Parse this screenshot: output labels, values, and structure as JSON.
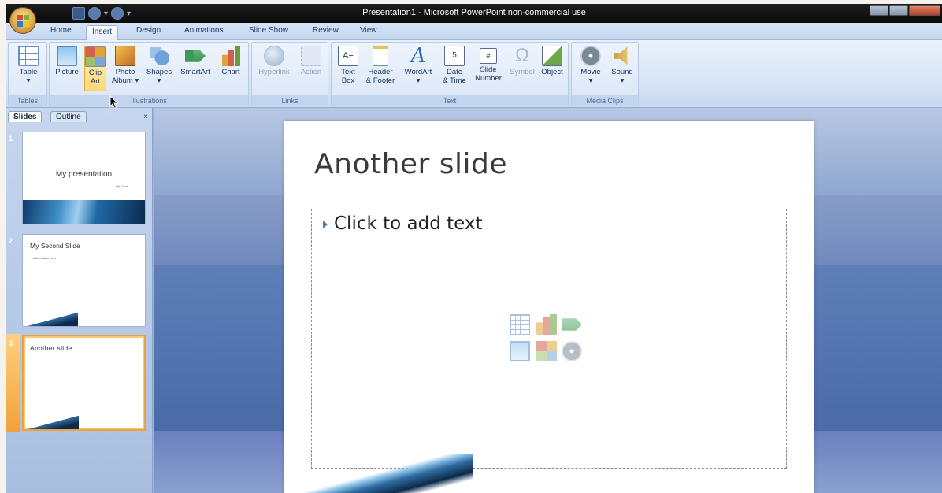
{
  "window": {
    "title": "Presentation1 - Microsoft PowerPoint non-commercial use"
  },
  "ribbon_tabs": [
    "Home",
    "Insert",
    "Design",
    "Animations",
    "Slide Show",
    "Review",
    "View"
  ],
  "active_tab": "Insert",
  "groups": {
    "tables": {
      "label": "Tables",
      "buttons": {
        "table": "Table"
      }
    },
    "illustrations": {
      "label": "Illustrations",
      "buttons": {
        "picture": "Picture",
        "clip_art_1": "Clip",
        "clip_art_2": "Art",
        "photo_album_1": "Photo",
        "photo_album_2": "Album",
        "shapes": "Shapes",
        "smartart": "SmartArt",
        "chart": "Chart"
      }
    },
    "links": {
      "label": "Links",
      "buttons": {
        "hyperlink": "Hyperlink",
        "action": "Action"
      }
    },
    "text": {
      "label": "Text",
      "buttons": {
        "text_box_1": "Text",
        "text_box_2": "Box",
        "header_footer_1": "Header",
        "header_footer_2": "& Footer",
        "wordart": "WordArt",
        "date_time_1": "Date",
        "date_time_2": "& Time",
        "slide_number_1": "Slide",
        "slide_number_2": "Number",
        "symbol": "Symbol",
        "object": "Object"
      }
    },
    "media": {
      "label": "Media Clips",
      "buttons": {
        "movie": "Movie",
        "sound": "Sound"
      }
    }
  },
  "pane": {
    "tabs": [
      "Slides",
      "Outline"
    ],
    "close": "×"
  },
  "slides": [
    {
      "number": "1",
      "title": "My presentation",
      "subtitle": "By Erica"
    },
    {
      "number": "2",
      "title": "My Second Slide",
      "bullet": "- information here"
    },
    {
      "number": "3",
      "title": "Another slide"
    }
  ],
  "current_slide": {
    "title": "Another slide",
    "body_placeholder": "Click to add text"
  },
  "colors": {
    "titlebar": "#111111",
    "ribbon": "#dbe6f6",
    "selection": "#f2a13a",
    "background": "#9fb2cf"
  }
}
